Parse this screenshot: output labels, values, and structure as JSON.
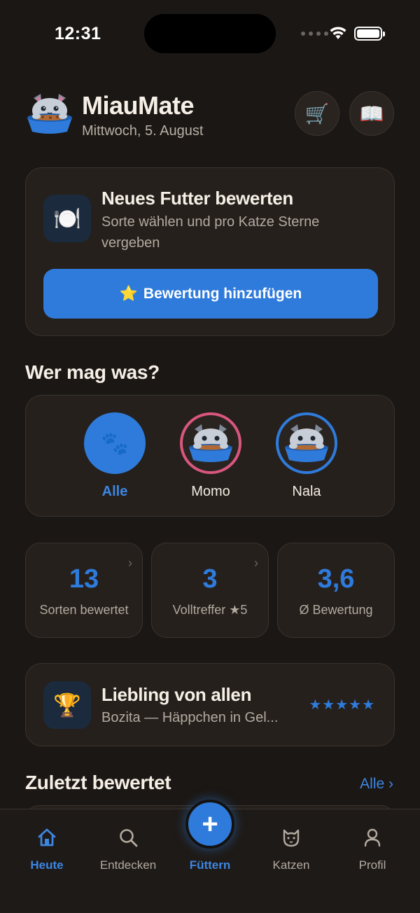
{
  "status": {
    "time": "12:31"
  },
  "header": {
    "title": "MiauMate",
    "date": "Mittwoch, 5. August",
    "cart_icon": "🛒",
    "book_icon": "📖"
  },
  "rate_card": {
    "icon": "🍽️",
    "title": "Neues Futter bewerten",
    "subtitle": "Sorte wählen und pro Katze Sterne vergeben",
    "button_icon": "⭐",
    "button_label": "Bewertung hinzufügen"
  },
  "cats_section": {
    "title": "Wer mag was?",
    "all_icon": "🐾",
    "items": [
      {
        "name": "Alle",
        "active": true
      },
      {
        "name": "Momo",
        "ring": "#d9567e"
      },
      {
        "name": "Nala",
        "ring": "#2f7bdb"
      }
    ]
  },
  "stats": [
    {
      "value": "13",
      "label": "Sorten bewertet",
      "chevron": "›"
    },
    {
      "value": "3",
      "label": "Volltreffer ★5",
      "chevron": "›"
    },
    {
      "value": "3,6",
      "label": "Ø Bewertung"
    }
  ],
  "favorite": {
    "icon": "🏆",
    "title": "Liebling von allen",
    "subtitle": "Bozita — Häppchen in Gel...",
    "stars": "★★★★★",
    "rating": 5
  },
  "recent": {
    "title": "Zuletzt bewertet",
    "see_all": "Alle ›"
  },
  "tabs": [
    {
      "label": "Heute",
      "icon": "home-icon",
      "active": true
    },
    {
      "label": "Entdecken",
      "icon": "search-icon"
    },
    {
      "label": "Füttern",
      "icon": "plus-icon",
      "fab": "+"
    },
    {
      "label": "Katzen",
      "icon": "cat-icon"
    },
    {
      "label": "Profil",
      "icon": "person-icon"
    }
  ],
  "colors": {
    "background": "#1b1714",
    "card": "#25201c",
    "accent": "#2f7bdb",
    "momo_ring": "#d9567e",
    "text_muted": "#b3aaa0"
  }
}
